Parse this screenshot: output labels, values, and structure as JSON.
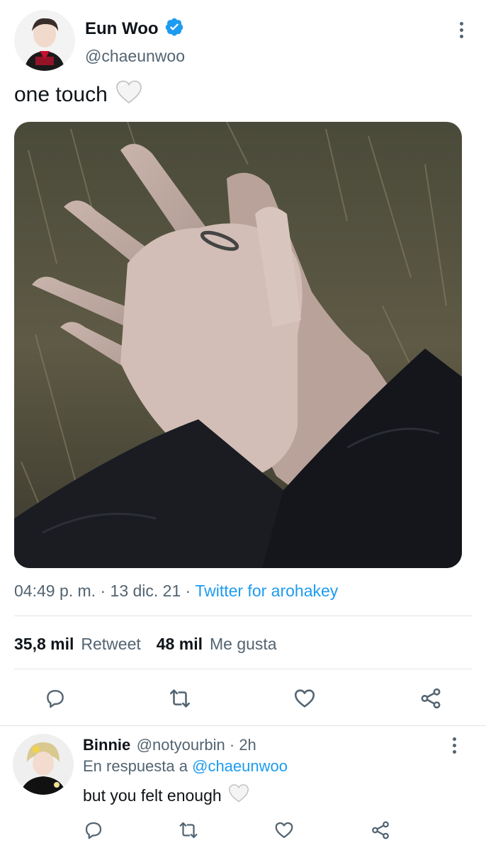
{
  "tweet": {
    "author": {
      "display_name": "Eun Woo",
      "handle": "@chaeunwoo",
      "verified": true
    },
    "text": "one touch",
    "emoji_icon": "white-heart-icon",
    "meta": {
      "time": "04:49 p. m.",
      "separator1": " · ",
      "date": "13 dic. 21",
      "separator2": " · ",
      "source": "Twitter for arohakey"
    },
    "stats": {
      "retweets_count": "35,8 mil",
      "retweets_label": "Retweet",
      "likes_count": "48 mil",
      "likes_label": "Me gusta"
    },
    "actions": [
      "reply-icon",
      "retweet-icon",
      "like-icon",
      "share-icon"
    ]
  },
  "reply": {
    "display_name": "Binnie",
    "handle": "@notyourbin",
    "time": " · 2h",
    "reply_prefix": "En respuesta a ",
    "reply_target": "@chaeunwoo",
    "text": "but you felt enough",
    "emoji_icon": "white-heart-icon",
    "actions": [
      "reply-icon",
      "retweet-icon",
      "like-icon",
      "share-icon"
    ]
  },
  "colors": {
    "link": "#1d9bf0",
    "secondary_text": "#536471",
    "primary_text": "#0f1419",
    "verified_badge": "#1d9bf0"
  }
}
